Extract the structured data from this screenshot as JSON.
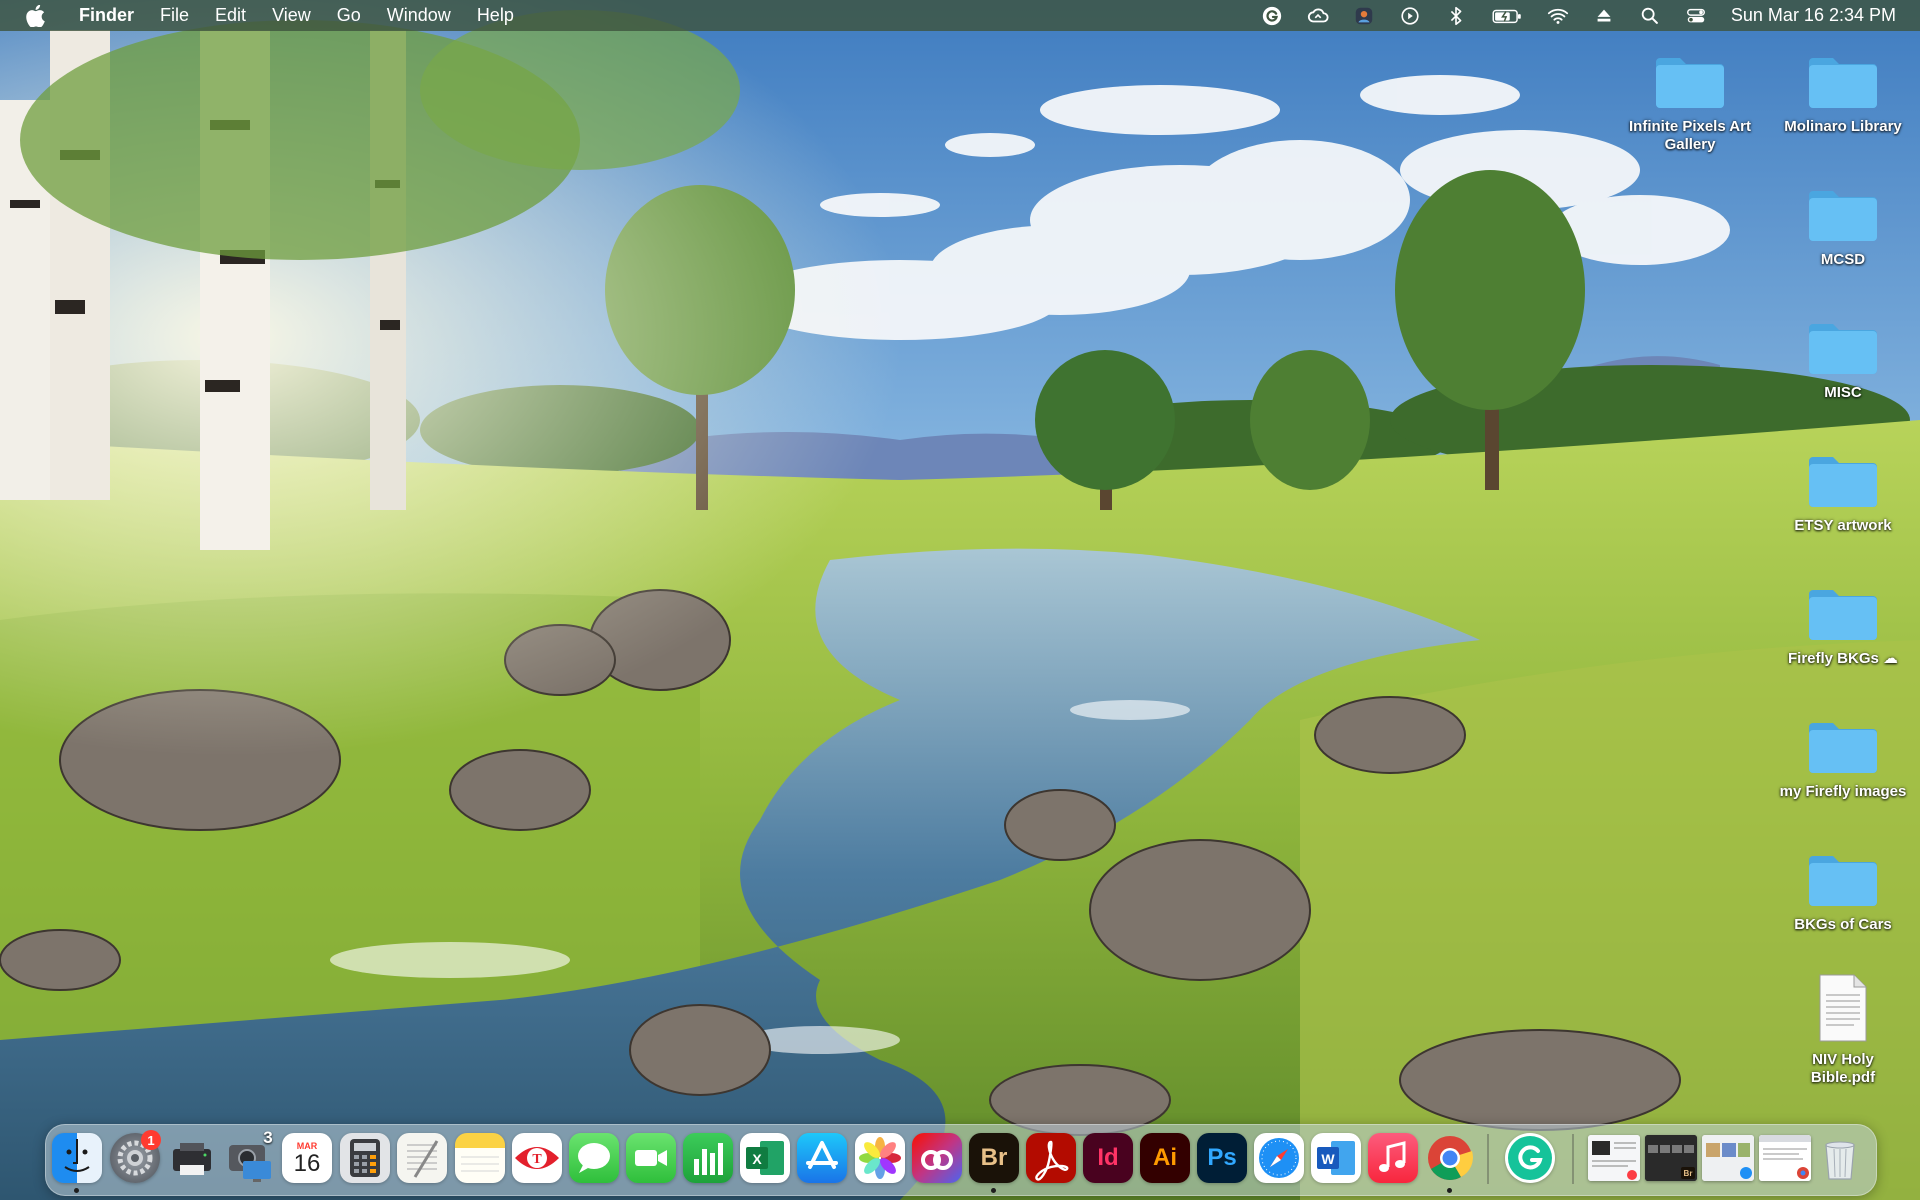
{
  "menubar": {
    "app_name": "Finder",
    "menus": [
      "File",
      "Edit",
      "View",
      "Go",
      "Window",
      "Help"
    ],
    "status_icons": [
      "grammarly-icon",
      "creative-cloud-icon",
      "profile-icon",
      "play-icon",
      "bluetooth-icon",
      "battery-icon",
      "wifi-icon",
      "eject-icon",
      "search-icon",
      "control-center-icon"
    ],
    "clock": "Sun Mar 16  2:34 PM"
  },
  "desktop": {
    "items": [
      {
        "label": "Infinite Pixels Art Gallery",
        "kind": "folder"
      },
      {
        "label": "Molinaro Library",
        "kind": "folder"
      },
      {
        "label": "MCSD",
        "kind": "folder"
      },
      {
        "label": "MISC",
        "kind": "folder"
      },
      {
        "label": "ETSY artwork",
        "kind": "folder"
      },
      {
        "label": "Firefly BKGs",
        "kind": "folder"
      },
      {
        "label": "my Firefly images",
        "kind": "folder"
      },
      {
        "label": "BKGs of Cars",
        "kind": "folder"
      },
      {
        "label": "NIV Holy Bible.pdf",
        "kind": "pdf"
      }
    ],
    "folder_color": "#5bb8f0"
  },
  "dock": {
    "apps": [
      {
        "name": "Finder",
        "icon": "finder-icon",
        "running": true
      },
      {
        "name": "System Settings",
        "icon": "settings-icon",
        "badge": "1",
        "running": false
      },
      {
        "name": "Printer",
        "icon": "printer-icon",
        "running": false
      },
      {
        "name": "Screenshot",
        "icon": "camera-icon",
        "badge": "3",
        "running": false
      },
      {
        "name": "Calendar",
        "icon": "calendar-icon",
        "month": "MAR",
        "day": "16",
        "running": false
      },
      {
        "name": "Calculator",
        "icon": "calculator-icon",
        "running": false
      },
      {
        "name": "TextEdit",
        "icon": "textedit-icon",
        "running": false
      },
      {
        "name": "Notes",
        "icon": "notes-icon",
        "running": false
      },
      {
        "name": "Preview",
        "icon": "preview-icon",
        "running": false
      },
      {
        "name": "Messages",
        "icon": "messages-icon",
        "running": false
      },
      {
        "name": "FaceTime",
        "icon": "facetime-icon",
        "running": false
      },
      {
        "name": "Numbers",
        "icon": "numbers-icon",
        "running": false
      },
      {
        "name": "Excel",
        "icon": "excel-icon",
        "letter": "X",
        "running": false
      },
      {
        "name": "App Store",
        "icon": "app-store-icon",
        "running": false
      },
      {
        "name": "Photos",
        "icon": "photos-icon",
        "running": false
      },
      {
        "name": "Creative Cloud",
        "icon": "creative-cloud-icon",
        "running": false
      },
      {
        "name": "Bridge",
        "icon": "bridge-icon",
        "letter": "Br",
        "running": true
      },
      {
        "name": "Acrobat",
        "icon": "acrobat-icon",
        "running": false
      },
      {
        "name": "InDesign",
        "icon": "indesign-icon",
        "letter": "Id",
        "running": false
      },
      {
        "name": "Illustrator",
        "icon": "illustrator-icon",
        "letter": "Ai",
        "running": false
      },
      {
        "name": "Photoshop",
        "icon": "photoshop-icon",
        "letter": "Ps",
        "running": false
      },
      {
        "name": "Safari",
        "icon": "safari-icon",
        "running": false
      },
      {
        "name": "Word",
        "icon": "word-icon",
        "letter": "W",
        "running": false
      },
      {
        "name": "Music",
        "icon": "music-icon",
        "running": false
      },
      {
        "name": "Chrome",
        "icon": "chrome-icon",
        "running": true
      },
      {
        "name": "Grammarly",
        "icon": "grammarly-icon",
        "letter": "G",
        "running": false
      }
    ],
    "minimized": [
      "window-thumbnail",
      "bridge-window-thumbnail",
      "safari-window-thumbnail",
      "browser-window-thumbnail"
    ],
    "trash": "trash-icon"
  }
}
